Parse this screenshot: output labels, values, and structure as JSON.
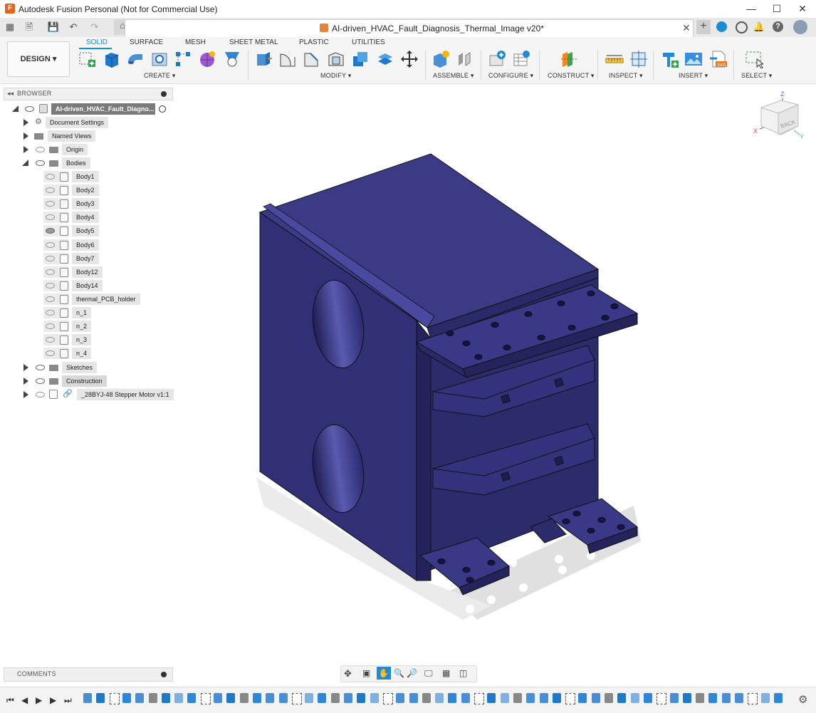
{
  "window": {
    "title": "Autodesk Fusion Personal (Not for Commercial Use)",
    "controls": [
      "minimize",
      "maximize",
      "close"
    ]
  },
  "document_tab": {
    "title": "AI-driven_HVAC_Fault_Diagnosis_Thermal_Image v20*"
  },
  "toolbar": {
    "workspace": "DESIGN ▾",
    "tabs": [
      "SOLID",
      "SURFACE",
      "MESH",
      "SHEET METAL",
      "PLASTIC",
      "UTILITIES"
    ],
    "active_tab": "SOLID",
    "groups": [
      "CREATE ▾",
      "MODIFY ▾",
      "ASSEMBLE ▾",
      "CONFIGURE ▾",
      "CONSTRUCT ▾",
      "INSPECT ▾",
      "INSERT ▾",
      "SELECT ▾"
    ]
  },
  "browser": {
    "header": "BROWSER",
    "root": "AI-driven_HVAC_Fault_Diagno...",
    "top_items": [
      {
        "label": "Document Settings"
      },
      {
        "label": "Named Views"
      },
      {
        "label": "Origin"
      },
      {
        "label": "Bodies"
      }
    ],
    "bodies": [
      {
        "label": "Body1",
        "visible": false
      },
      {
        "label": "Body2",
        "visible": false
      },
      {
        "label": "Body3",
        "visible": false
      },
      {
        "label": "Body4",
        "visible": false
      },
      {
        "label": "Body5",
        "visible": true
      },
      {
        "label": "Body6",
        "visible": false
      },
      {
        "label": "Body7",
        "visible": false
      },
      {
        "label": "Body12",
        "visible": false
      },
      {
        "label": "Body14",
        "visible": false
      },
      {
        "label": "thermal_PCB_holder",
        "visible": false
      },
      {
        "label": "n_1",
        "visible": false
      },
      {
        "label": "n_2",
        "visible": false
      },
      {
        "label": "n_3",
        "visible": false
      },
      {
        "label": "n_4",
        "visible": false
      }
    ],
    "bottom_items": [
      {
        "label": "Sketches"
      },
      {
        "label": "Construction"
      },
      {
        "label": "_28BYJ-48 Stepper Motor v1:1"
      }
    ]
  },
  "comments": {
    "header": "COMMENTS"
  },
  "viewcube": {
    "face": "BACK",
    "axes": [
      "Z",
      "X",
      "Y"
    ]
  },
  "colors": {
    "model": "#2f2d70",
    "model_light": "#3f3e8e",
    "model_dark": "#23225a",
    "accent": "#0696d7"
  }
}
